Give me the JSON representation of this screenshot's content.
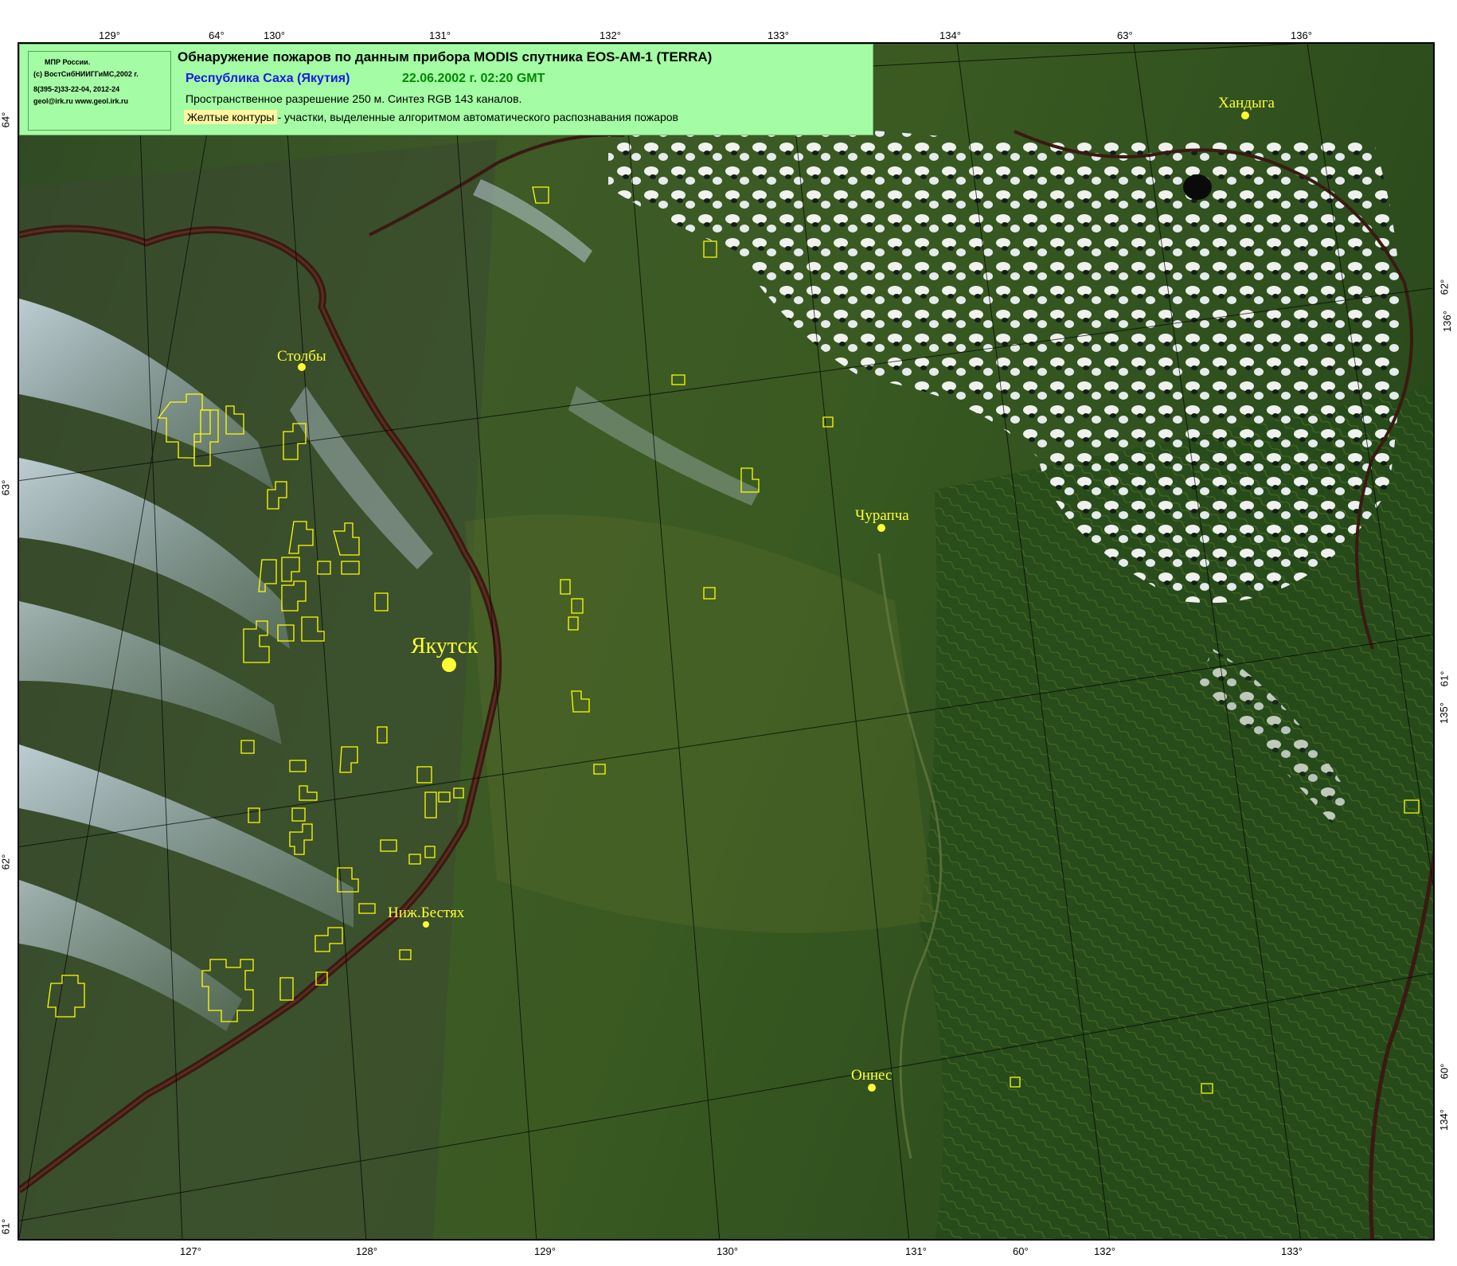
{
  "legend": {
    "credits": [
      "МПР России.",
      "(c) ВостСибНИИГГиМС,2002 г.",
      "8(395-2)33-22-04, 2012-24",
      "geol@irk.ru  www.geol.irk.ru"
    ],
    "title": "Обнаружение пожаров по данным прибора MODIS спутника EOS-AM-1 (TERRA)",
    "region": "Республика Саха (Якутия)",
    "date": "22.06.2002 г. 02:20 GMT",
    "resolution": "Пространственное разрешение 250 м. Синтез RGB 143 каналов.",
    "key_swatch_label": "Желтые контуры",
    "key_text": " - участки, выделенные алгоритмом автоматического распознавания пожаров"
  },
  "ticks": {
    "top": [
      "129°",
      "64°",
      "130°",
      "131°",
      "132°",
      "133°",
      "134°",
      "63°",
      "136°"
    ],
    "bottom": [
      "127°",
      "128°",
      "129°",
      "130°",
      "131°",
      "60°",
      "132°",
      "133°"
    ],
    "left": [
      "64°",
      "63°",
      "62°",
      "61°"
    ],
    "right": [
      "62°",
      "136°",
      "61°",
      "135°",
      "60°",
      "134°"
    ]
  },
  "cities": {
    "yakutsk": "Якутск",
    "stolby": "Столбы",
    "churapcha": "Чурапча",
    "khandyga": "Хандыга",
    "nizh_bestyakh": "Ниж.Бестях",
    "onnes": "Оннес"
  },
  "colors": {
    "fire_contour": "#ffff00",
    "city_label": "#ffff33",
    "river": "#3a1a12",
    "forest_dark": "#1f3a18",
    "forest_light": "#4a6b2a",
    "smoke": "#c8d8e8",
    "cloud": "#ffffff"
  }
}
